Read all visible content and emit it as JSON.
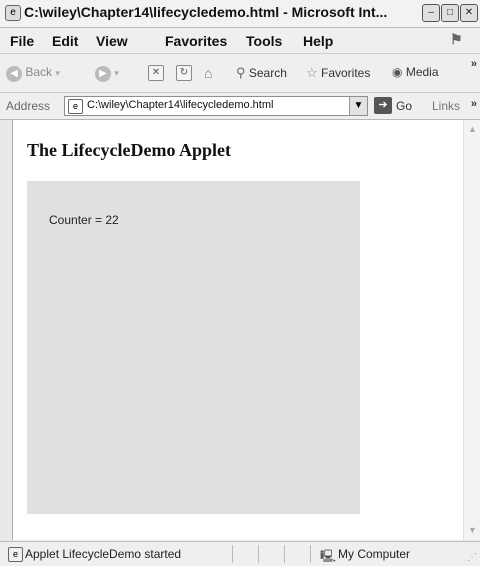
{
  "window": {
    "title": "C:\\wiley\\Chapter14\\lifecycledemo.html - Microsoft Int...",
    "icon": "ie-page-icon",
    "minimize": "–",
    "maximize": "□",
    "close": "✕"
  },
  "menu": {
    "file": "File",
    "edit": "Edit",
    "view": "View",
    "favorites": "Favorites",
    "tools": "Tools",
    "help": "Help"
  },
  "toolbar": {
    "back": "Back",
    "search": "Search",
    "favorites": "Favorites",
    "media": "Media",
    "more": "»"
  },
  "address": {
    "label": "Address",
    "url": "C:\\wiley\\Chapter14\\lifecycledemo.html",
    "go": "Go",
    "links": "Links",
    "more": "»"
  },
  "page": {
    "heading": "The LifecycleDemo Applet",
    "counter_text": "Counter = 22"
  },
  "status": {
    "message": "Applet LifecycleDemo started",
    "zone": "My Computer"
  }
}
